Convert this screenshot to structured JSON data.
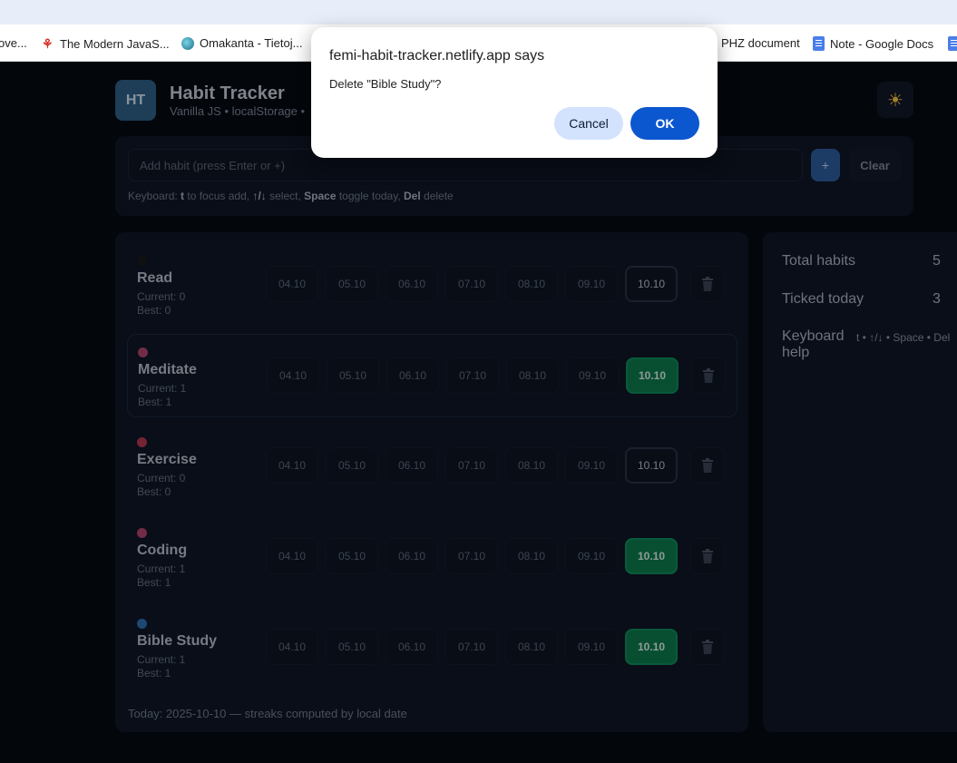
{
  "browser": {
    "bookmarks": [
      {
        "label": "ove...",
        "icon": "none"
      },
      {
        "label": "The Modern JavaS...",
        "icon": "figure-icon"
      },
      {
        "label": "Omakanta - Tietoj...",
        "icon": "globe-icon"
      },
      {
        "label": "PHZ document",
        "icon": "none"
      },
      {
        "label": "Note - Google Docs",
        "icon": "docs-icon"
      },
      {
        "label": "",
        "icon": "docs-icon"
      }
    ]
  },
  "app": {
    "logo": "HT",
    "title": "Habit Tracker",
    "subtitle": "Vanilla JS • localStorage •",
    "theme_icon": "☀",
    "add": {
      "placeholder": "Add habit (press Enter or +)",
      "plus_label": "+",
      "clear_label": "Clear"
    },
    "kb_hint": {
      "p1": "Keyboard: ",
      "k1": "t",
      "p2": " to focus add, ",
      "k2": "↑/↓",
      "p3": " select, ",
      "k3": "Space",
      "p4": " toggle today, ",
      "k4": "Del",
      "p5": " delete"
    },
    "days": [
      "04.10",
      "05.10",
      "06.10",
      "07.10",
      "08.10",
      "09.10",
      "10.10"
    ],
    "habits": [
      {
        "name": "Read",
        "current": "Current: 0",
        "best": "Best: 0",
        "color": "#1a1a1a",
        "today_done": false,
        "selected": false
      },
      {
        "name": "Meditate",
        "current": "Current: 1",
        "best": "Best: 1",
        "color": "#b0446f",
        "today_done": true,
        "selected": true
      },
      {
        "name": "Exercise",
        "current": "Current: 0",
        "best": "Best: 0",
        "color": "#b3384e",
        "today_done": false,
        "selected": false
      },
      {
        "name": "Coding",
        "current": "Current: 1",
        "best": "Best: 1",
        "color": "#b0446f",
        "today_done": true,
        "selected": false
      },
      {
        "name": "Bible Study",
        "current": "Current: 1",
        "best": "Best: 1",
        "color": "#2f6fb3",
        "today_done": true,
        "selected": false
      }
    ],
    "footer": "Today: 2025-10-10 — streaks computed by local date",
    "stats": {
      "total_label": "Total habits",
      "total_value": "5",
      "ticked_label": "Ticked today",
      "ticked_value": "3",
      "kb_label": "Keyboard help",
      "kb_value": "t • ↑/↓ • Space • Del"
    }
  },
  "dialog": {
    "title": "femi-habit-tracker.netlify.app says",
    "message": "Delete \"Bible Study\"?",
    "cancel_label": "Cancel",
    "ok_label": "OK"
  }
}
